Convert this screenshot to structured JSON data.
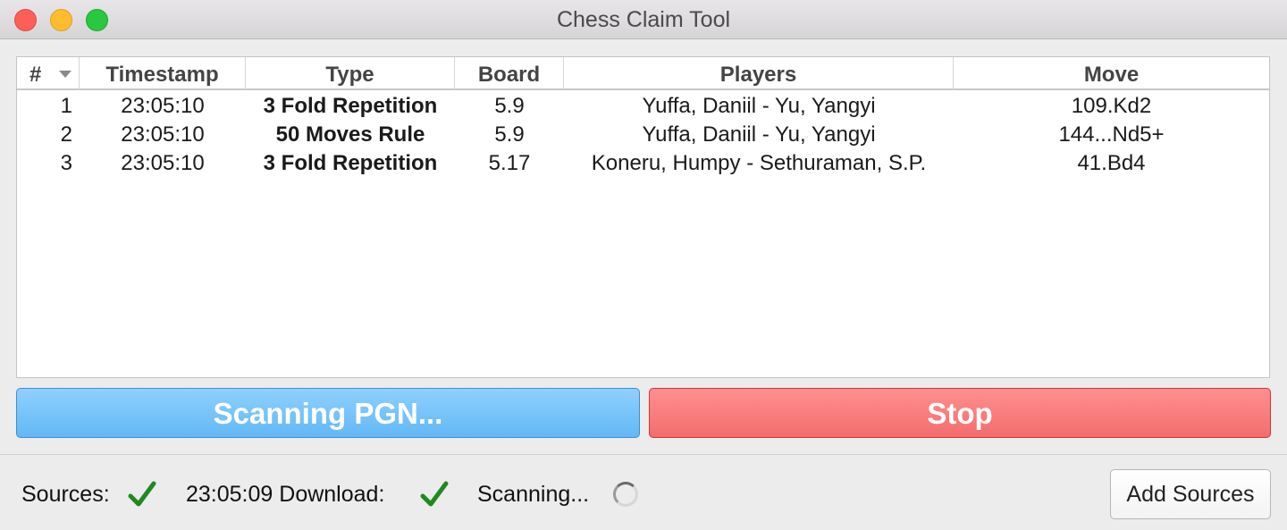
{
  "window": {
    "title": "Chess Claim Tool"
  },
  "table": {
    "columns": [
      "#",
      "Timestamp",
      "Type",
      "Board",
      "Players",
      "Move"
    ],
    "rows": [
      {
        "n": "1",
        "timestamp": "23:05:10",
        "type": "3 Fold Repetition",
        "board": "5.9",
        "players": "Yuffa, Daniil - Yu, Yangyi",
        "move": "109.Kd2"
      },
      {
        "n": "2",
        "timestamp": "23:05:10",
        "type": "50 Moves Rule",
        "board": "5.9",
        "players": "Yuffa, Daniil - Yu, Yangyi",
        "move": "144...Nd5+"
      },
      {
        "n": "3",
        "timestamp": "23:05:10",
        "type": "3 Fold Repetition",
        "board": "5.17",
        "players": "Koneru, Humpy - Sethuraman, S.P.",
        "move": "41.Bd4"
      }
    ]
  },
  "buttons": {
    "scan_label": "Scanning PGN...",
    "stop_label": "Stop",
    "add_sources_label": "Add Sources"
  },
  "status": {
    "sources_label": "Sources:",
    "download_label": "23:05:09 Download:",
    "scanning_label": "Scanning..."
  },
  "colors": {
    "scan_button": "#63b8f5",
    "stop_button": "#f46d6d",
    "check": "#1f8a1f"
  },
  "icons": {
    "sort": "chevron-down-icon",
    "status_ok": "checkmark-icon",
    "busy": "spinner-icon"
  }
}
